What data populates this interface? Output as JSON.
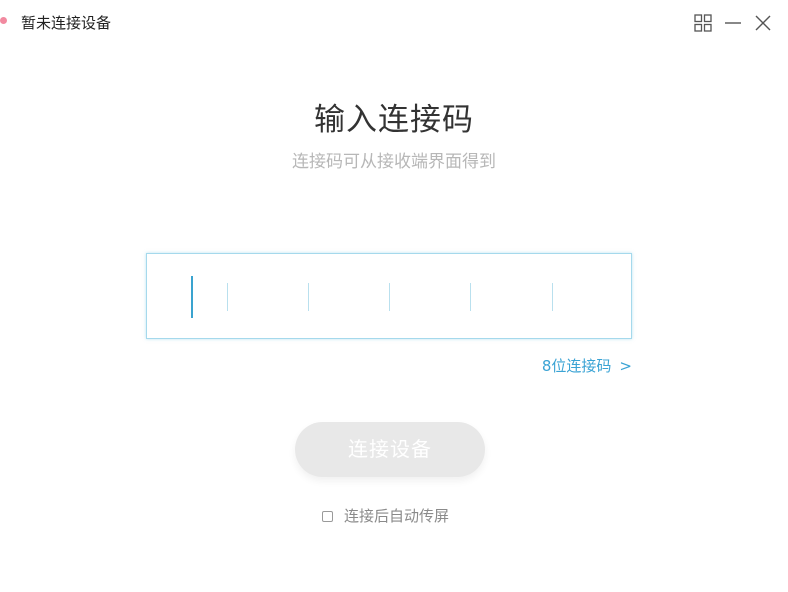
{
  "window": {
    "title": "暂未连接设备",
    "status_color": "#f28aa0"
  },
  "controls": {
    "layout_icon": "grid-icon",
    "minimize_icon": "minimize-icon",
    "close_icon": "close-icon"
  },
  "main": {
    "heading": "输入连接码",
    "subheading": "连接码可从接收端界面得到",
    "code_value": "",
    "mode_link_label": "8位连接码",
    "mode_link_chevron": ">",
    "connect_button_label": "连接设备",
    "auto_cast_label": "连接后自动传屏",
    "auto_cast_checked": false
  },
  "colors": {
    "accent": "#3aa3d4",
    "input_border": "#a5d9ec",
    "button_disabled": "#e8e8e8"
  }
}
